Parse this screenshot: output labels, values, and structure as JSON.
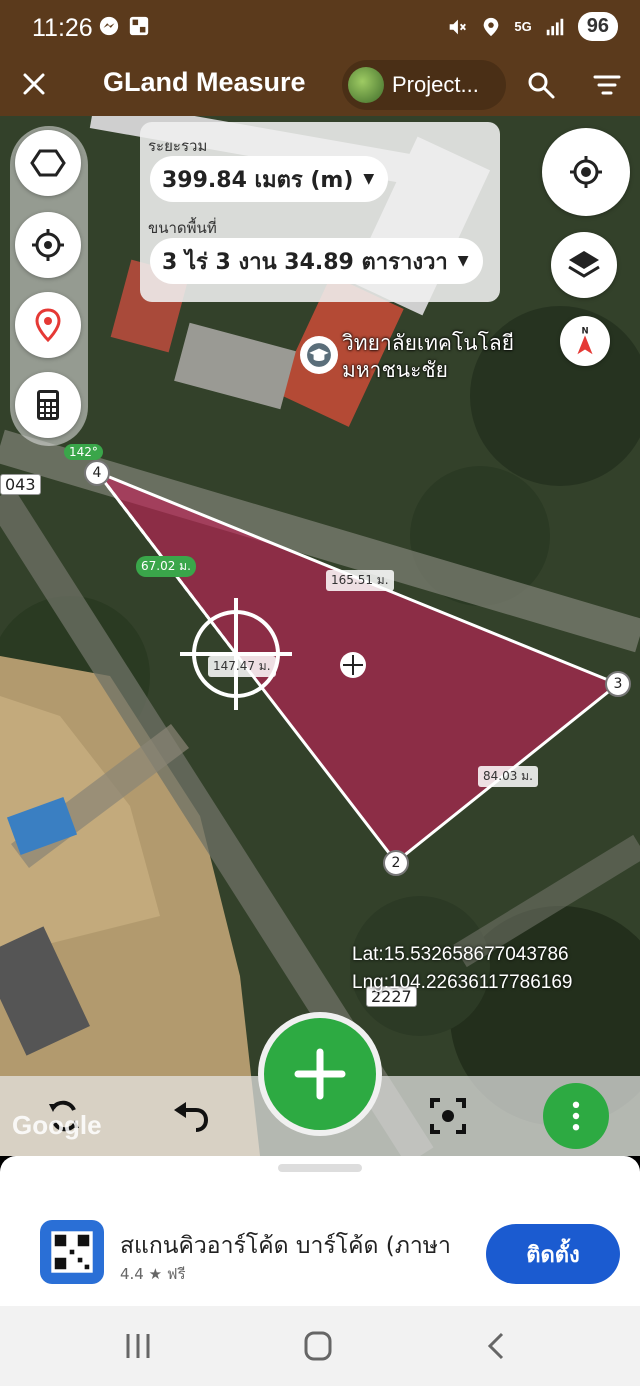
{
  "status_bar": {
    "time": "11:26",
    "network": "5G",
    "battery": "96"
  },
  "app_bar": {
    "title": "GLand Measure",
    "project_label": "Project..."
  },
  "measure_panel": {
    "distance_label": "ระยะรวม",
    "distance_value": "399.84 เมตร (m)",
    "area_label": "ขนาดพื้นที่",
    "area_value": "3 ไร่ 3 งาน 34.89 ตารางวา"
  },
  "map": {
    "place_name_line1": "วิทยาลัยเทคโนโลยี",
    "place_name_line2": "มหาชนะชัย",
    "segments": {
      "seg_top": "165.51 ม.",
      "seg_left": "67.02 ม.",
      "seg_diag": "147.47 ม.",
      "seg_right": "84.03 ม."
    },
    "angle_label": "142°",
    "vertices": [
      "4",
      "3",
      "2"
    ],
    "road_left": "043",
    "road_bottom": "2227",
    "lat": "Lat:15.532658677043786",
    "lng": "Lng:104.22636117786169",
    "attribution": "Google"
  },
  "ad": {
    "title": "สแกนคิวอาร์โค้ด บาร์โค้ด (ภาษา",
    "rating": "4.4 ★  ฟรี",
    "install_label": "ติดตั้ง"
  },
  "icons": {
    "polygon": "polygon-icon",
    "gps": "crosshair-icon",
    "pin": "location-pin-icon",
    "calculator": "calculator-icon",
    "locate": "my-location-icon",
    "layers": "layers-icon",
    "compass": "compass-icon",
    "refresh": "refresh-icon",
    "undo": "undo-icon",
    "focus": "focus-icon",
    "add": "plus-icon",
    "more": "more-vertical-icon"
  },
  "colors": {
    "app_bar": "#5b3a1c",
    "polygon_fill": "#c8205a",
    "fab_green": "#2daa42",
    "install_blue": "#1b5bd0"
  }
}
